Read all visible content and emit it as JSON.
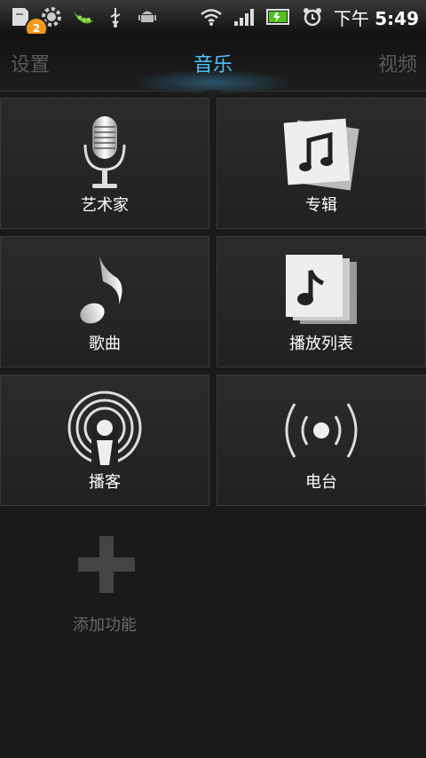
{
  "status_bar": {
    "notification_count": "2",
    "time_prefix": "下午",
    "time_value": "5:49"
  },
  "tabs": {
    "left": "设置",
    "center": "音乐",
    "right": "视频"
  },
  "tiles": [
    {
      "label": "艺术家",
      "icon": "microphone-icon"
    },
    {
      "label": "专辑",
      "icon": "album-icon"
    },
    {
      "label": "歌曲",
      "icon": "music-note-icon"
    },
    {
      "label": "播放列表",
      "icon": "playlist-icon"
    },
    {
      "label": "播客",
      "icon": "podcast-icon"
    },
    {
      "label": "电台",
      "icon": "radio-icon"
    }
  ],
  "add_feature": {
    "label": "添加功能",
    "icon": "plus-icon"
  },
  "colors": {
    "accent": "#4fc3ff",
    "badge": "#f39a1c"
  }
}
